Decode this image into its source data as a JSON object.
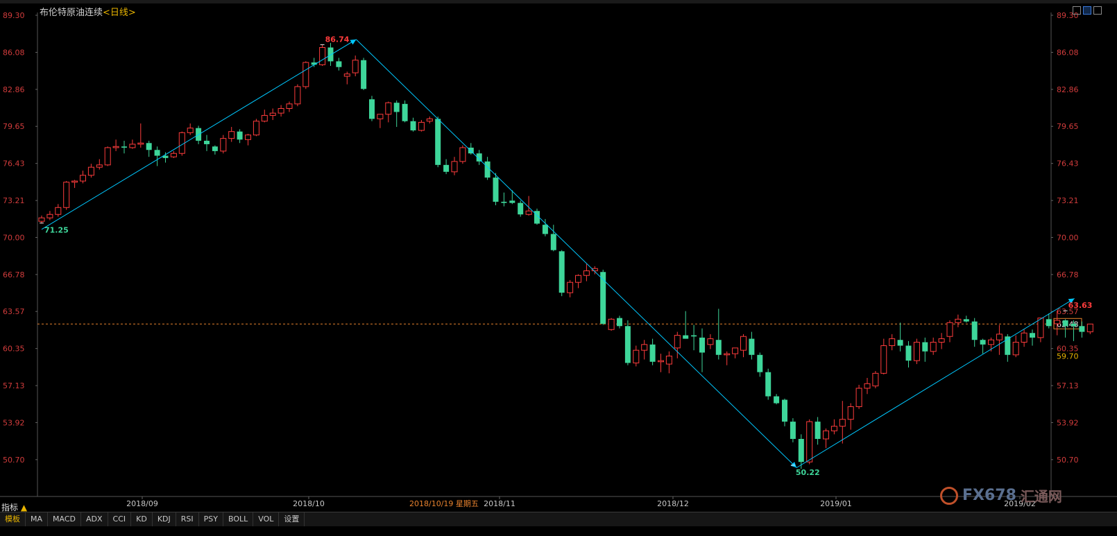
{
  "header": {
    "title": "布伦特原油连续",
    "period": "<日线>"
  },
  "footer": {
    "status_label": "指标",
    "tabs": [
      "模板",
      "MA",
      "MACD",
      "ADX",
      "CCI",
      "KD",
      "KDJ",
      "RSI",
      "PSY",
      "BOLL",
      "VOL",
      "设置"
    ]
  },
  "crosshair_date": "2018/10/19  星期五",
  "watermark": {
    "brand": "FX678",
    "cn": "汇通网"
  },
  "colors": {
    "up": "#ff3c3c",
    "down": "#3ed69a",
    "axis_text": "#d23c3c",
    "trend": "#00c8ff",
    "last_price_line": "#e8822e",
    "grid": "#2a2a2a"
  },
  "chart_data": {
    "type": "candlestick",
    "y_ticks": [
      89.3,
      86.08,
      82.86,
      79.65,
      76.43,
      73.21,
      70.0,
      66.78,
      63.57,
      60.35,
      57.13,
      53.92,
      50.7
    ],
    "ylim": [
      47.5,
      89.3
    ],
    "x_ticks": [
      "2018/09",
      "2018/10",
      "2018/11",
      "2018/12",
      "2019/01",
      "2019/02"
    ],
    "last_price": 62.48,
    "right_label_extra": 59.7,
    "annotations": [
      {
        "label": "71.25",
        "value": 71.25,
        "kind": "low"
      },
      {
        "label": "86.74",
        "value": 86.74,
        "kind": "high"
      },
      {
        "label": "50.22",
        "value": 50.22,
        "kind": "low"
      },
      {
        "label": "63.63",
        "value": 63.63,
        "kind": "high"
      }
    ],
    "trend_lines": [
      {
        "from": {
          "date": "2018-08-09",
          "value": 70.7
        },
        "to": {
          "date": "2018-10-08",
          "value": 87.2
        }
      },
      {
        "from": {
          "date": "2018-10-08",
          "value": 87.2
        },
        "to": {
          "date": "2018-12-31",
          "value": 50.0
        }
      },
      {
        "from": {
          "date": "2018-12-31",
          "value": 50.0
        },
        "to": {
          "date": "2019-02-22",
          "value": 64.7
        }
      }
    ],
    "ohlc": [
      [
        71.4,
        71.9,
        71.2,
        71.7
      ],
      [
        71.7,
        72.3,
        71.5,
        72.0
      ],
      [
        72.0,
        72.9,
        71.8,
        72.6
      ],
      [
        72.6,
        74.9,
        72.4,
        74.8
      ],
      [
        74.8,
        75.0,
        74.3,
        74.9
      ],
      [
        74.9,
        75.8,
        74.7,
        75.4
      ],
      [
        75.4,
        76.4,
        75.2,
        76.1
      ],
      [
        76.1,
        76.8,
        75.9,
        76.3
      ],
      [
        76.3,
        77.9,
        76.2,
        77.8
      ],
      [
        77.8,
        78.5,
        77.5,
        77.9
      ],
      [
        77.9,
        78.4,
        77.3,
        77.8
      ],
      [
        77.8,
        78.5,
        77.7,
        78.1
      ],
      [
        78.1,
        79.9,
        77.8,
        78.2
      ],
      [
        78.2,
        78.4,
        77.0,
        77.6
      ],
      [
        77.6,
        77.9,
        76.2,
        77.1
      ],
      [
        77.1,
        77.4,
        76.5,
        76.9
      ],
      [
        77.0,
        77.5,
        76.9,
        77.3
      ],
      [
        77.3,
        79.2,
        77.1,
        79.1
      ],
      [
        79.1,
        79.9,
        78.9,
        79.5
      ],
      [
        79.5,
        79.7,
        78.1,
        78.4
      ],
      [
        78.4,
        78.9,
        77.5,
        78.1
      ],
      [
        77.9,
        78.0,
        77.2,
        77.5
      ],
      [
        77.5,
        78.9,
        77.3,
        78.6
      ],
      [
        78.6,
        79.6,
        78.3,
        79.2
      ],
      [
        79.2,
        79.4,
        78.2,
        78.5
      ],
      [
        78.5,
        79.0,
        78.0,
        78.9
      ],
      [
        78.9,
        80.3,
        78.8,
        80.1
      ],
      [
        80.1,
        81.1,
        80.0,
        80.6
      ],
      [
        80.6,
        81.2,
        80.2,
        80.8
      ],
      [
        80.8,
        81.5,
        80.5,
        81.2
      ],
      [
        81.2,
        81.8,
        80.9,
        81.6
      ],
      [
        81.6,
        83.3,
        81.4,
        83.1
      ],
      [
        83.1,
        85.3,
        82.9,
        85.2
      ],
      [
        85.2,
        85.6,
        84.8,
        85.0
      ],
      [
        85.0,
        86.74,
        84.9,
        86.5
      ],
      [
        86.5,
        86.9,
        84.9,
        85.3
      ],
      [
        85.3,
        85.6,
        84.5,
        84.8
      ],
      [
        84.0,
        84.4,
        83.3,
        84.2
      ],
      [
        84.3,
        85.8,
        84.0,
        85.4
      ],
      [
        85.4,
        85.6,
        82.8,
        82.9
      ],
      [
        82.0,
        82.3,
        80.1,
        80.3
      ],
      [
        80.3,
        80.6,
        79.5,
        80.7
      ],
      [
        80.7,
        81.8,
        80.0,
        81.7
      ],
      [
        81.7,
        81.9,
        79.6,
        80.9
      ],
      [
        81.6,
        81.9,
        80.0,
        80.1
      ],
      [
        80.1,
        80.4,
        79.2,
        79.3
      ],
      [
        79.3,
        80.2,
        79.2,
        80.0
      ],
      [
        80.1,
        80.5,
        79.9,
        80.3
      ],
      [
        80.3,
        80.5,
        76.1,
        76.3
      ],
      [
        76.3,
        76.8,
        75.5,
        75.7
      ],
      [
        75.7,
        77.0,
        75.4,
        76.6
      ],
      [
        76.6,
        78.0,
        76.4,
        77.8
      ],
      [
        77.8,
        78.2,
        77.2,
        77.3
      ],
      [
        77.3,
        77.6,
        76.3,
        76.6
      ],
      [
        76.6,
        77.0,
        75.0,
        75.2
      ],
      [
        75.2,
        75.6,
        72.8,
        73.1
      ],
      [
        73.1,
        73.9,
        72.7,
        73.0
      ],
      [
        73.2,
        74.1,
        72.9,
        73.0
      ],
      [
        73.0,
        73.2,
        71.8,
        72.0
      ],
      [
        72.0,
        73.6,
        71.9,
        72.3
      ],
      [
        72.3,
        72.5,
        71.1,
        71.2
      ],
      [
        71.1,
        71.6,
        70.1,
        70.3
      ],
      [
        70.3,
        71.1,
        68.8,
        68.9
      ],
      [
        68.8,
        68.9,
        64.9,
        65.2
      ],
      [
        65.2,
        66.3,
        64.8,
        66.1
      ],
      [
        66.1,
        66.8,
        65.6,
        66.7
      ],
      [
        66.7,
        67.7,
        66.2,
        67.1
      ],
      [
        67.1,
        67.5,
        66.8,
        67.3
      ],
      [
        67.0,
        67.2,
        62.4,
        62.5
      ],
      [
        62.0,
        63.0,
        61.9,
        62.9
      ],
      [
        63.0,
        63.2,
        62.1,
        62.3
      ],
      [
        62.3,
        62.8,
        58.9,
        59.1
      ],
      [
        59.1,
        60.6,
        58.8,
        60.2
      ],
      [
        60.2,
        61.1,
        59.4,
        60.7
      ],
      [
        60.7,
        61.2,
        58.9,
        59.2
      ],
      [
        59.2,
        59.9,
        58.3,
        59.3
      ],
      [
        59.0,
        60.1,
        58.2,
        59.7
      ],
      [
        60.4,
        61.8,
        59.5,
        61.5
      ],
      [
        61.5,
        63.6,
        61.2,
        61.2
      ],
      [
        61.5,
        62.4,
        60.2,
        61.4
      ],
      [
        61.3,
        62.1,
        58.3,
        60.0
      ],
      [
        60.7,
        61.6,
        60.3,
        61.2
      ],
      [
        61.1,
        63.8,
        59.4,
        59.8
      ],
      [
        59.8,
        60.1,
        58.9,
        59.9
      ],
      [
        59.9,
        60.4,
        59.5,
        60.4
      ],
      [
        60.2,
        61.6,
        59.6,
        61.4
      ],
      [
        61.2,
        61.8,
        59.4,
        59.8
      ],
      [
        59.8,
        60.0,
        57.9,
        58.3
      ],
      [
        58.3,
        58.6,
        55.9,
        56.2
      ],
      [
        56.2,
        56.4,
        55.5,
        55.6
      ],
      [
        55.9,
        56.0,
        53.6,
        54.0
      ],
      [
        54.0,
        54.3,
        52.2,
        52.5
      ],
      [
        52.5,
        52.9,
        49.9,
        50.5
      ],
      [
        50.5,
        54.2,
        50.3,
        54.0
      ],
      [
        54.0,
        54.4,
        52.0,
        52.5
      ],
      [
        52.5,
        53.4,
        51.7,
        53.2
      ],
      [
        53.2,
        54.2,
        52.9,
        53.6
      ],
      [
        53.6,
        55.8,
        52.1,
        54.2
      ],
      [
        54.2,
        55.6,
        53.3,
        55.3
      ],
      [
        55.3,
        57.2,
        55.1,
        56.9
      ],
      [
        56.9,
        57.8,
        56.4,
        57.3
      ],
      [
        57.1,
        58.4,
        56.9,
        58.2
      ],
      [
        58.2,
        61.2,
        58.1,
        60.6
      ],
      [
        60.6,
        61.6,
        60.2,
        61.2
      ],
      [
        61.1,
        62.6,
        60.1,
        60.6
      ],
      [
        60.6,
        61.0,
        58.7,
        59.3
      ],
      [
        59.3,
        61.2,
        59.0,
        60.9
      ],
      [
        60.9,
        61.3,
        59.2,
        60.1
      ],
      [
        60.1,
        61.3,
        59.8,
        60.9
      ],
      [
        60.9,
        61.7,
        60.3,
        61.2
      ],
      [
        61.4,
        62.8,
        60.9,
        62.6
      ],
      [
        62.6,
        63.3,
        62.2,
        62.9
      ],
      [
        62.9,
        63.2,
        62.6,
        62.7
      ],
      [
        62.7,
        63.0,
        60.5,
        61.1
      ],
      [
        61.1,
        61.2,
        59.9,
        60.7
      ],
      [
        60.7,
        61.3,
        60.1,
        61.1
      ],
      [
        61.1,
        62.4,
        59.8,
        61.6
      ],
      [
        61.4,
        61.6,
        59.2,
        59.8
      ],
      [
        59.8,
        61.5,
        59.6,
        60.9
      ],
      [
        60.9,
        62.0,
        60.5,
        61.7
      ],
      [
        61.7,
        62.0,
        60.6,
        61.3
      ],
      [
        61.3,
        63.0,
        60.9,
        63.0
      ],
      [
        62.9,
        63.4,
        62.1,
        62.3
      ],
      [
        62.5,
        63.63,
        61.5,
        62.8
      ],
      [
        62.8,
        62.9,
        61.3,
        62.3
      ],
      [
        62.5,
        62.8,
        61.0,
        62.3
      ],
      [
        62.3,
        62.7,
        61.3,
        61.8
      ],
      [
        61.8,
        62.5,
        61.6,
        62.48
      ]
    ]
  }
}
